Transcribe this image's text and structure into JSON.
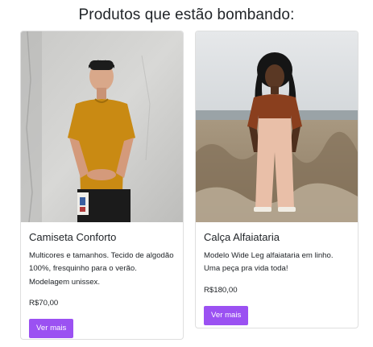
{
  "section": {
    "title": "Produtos que estão bombando:"
  },
  "products": [
    {
      "title": "Camiseta Conforto",
      "description": "Multicores e tamanhos. Tecido de algodão 100%, fresquinho para o verão. Modelagem unissex.",
      "price": "R$70,00",
      "button_label": "Ver mais",
      "image_icon": "man-yellow-tshirt-photo"
    },
    {
      "title": "Calça Alfaiataria",
      "description": "Modelo Wide Leg alfaiataria em linho. Uma peça pra vida toda!",
      "price": "R$180,00",
      "button_label": "Ver mais",
      "image_icon": "woman-wide-leg-pants-photo"
    }
  ],
  "colors": {
    "accent": "#9b51f2",
    "text": "#212529"
  }
}
